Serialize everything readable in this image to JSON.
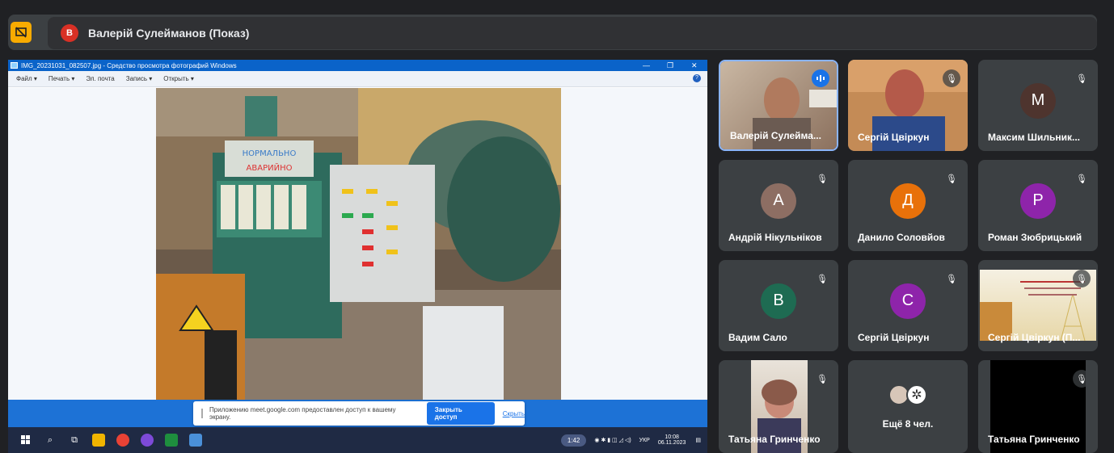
{
  "meet": {
    "presenter_initial": "В",
    "presenter_label": "Валерій Сулейманов (Показ)",
    "more_count_label": "Ещё 8 чел."
  },
  "screen": {
    "window_title": "IMG_20231031_082507.jpg - Средство просмотра фотографий Windows",
    "menu": [
      "Файл ▾",
      "Печать ▾",
      "Эл. почта",
      "Запись ▾",
      "Открыть ▾"
    ],
    "photo_sign_top": "НОРМАЛЬНО",
    "photo_sign_bottom": "АВАРИЙНО",
    "share_notice": "Приложению meet.google.com предоставлен доступ к вашему экрану.",
    "stop_sharing": "Закрыть доступ",
    "hide": "Скрыть",
    "tray_pill": "1:42",
    "tray_lang": "УКР",
    "time": "10:08",
    "date": "06.11.2023"
  },
  "participants": [
    {
      "name": "Валерій Сулейма...",
      "initial": "",
      "color": "",
      "type": "video-speaking"
    },
    {
      "name": "Сергій Цвіркун",
      "initial": "",
      "color": "",
      "type": "video-muted"
    },
    {
      "name": "Максим Шильник...",
      "initial": "М",
      "color": "#4e342e",
      "type": "avatar"
    },
    {
      "name": "Андрій Нікульніков",
      "initial": "А",
      "color": "#8d6e63",
      "type": "avatar"
    },
    {
      "name": "Данило Соловйов",
      "initial": "Д",
      "color": "#e8710a",
      "type": "avatar"
    },
    {
      "name": "Роман Зюбрицький",
      "initial": "Р",
      "color": "#8e24aa",
      "type": "avatar"
    },
    {
      "name": "Вадим Сало",
      "initial": "В",
      "color": "#1e6b52",
      "type": "avatar"
    },
    {
      "name": "Сергій Цвіркун",
      "initial": "С",
      "color": "#8e24aa",
      "type": "avatar"
    },
    {
      "name": "Сергій Цвіркун (П...",
      "initial": "",
      "color": "",
      "type": "slide"
    },
    {
      "name": "Татьяна Гринченко",
      "initial": "",
      "color": "",
      "type": "video-muted"
    },
    {
      "name": "Ещё 8 чел.",
      "initial": "",
      "color": "",
      "type": "more"
    },
    {
      "name": "Татьяна Гринченко",
      "initial": "",
      "color": "",
      "type": "black"
    }
  ],
  "colors": {
    "accent": "#1a73e8",
    "present": "#f9ab00",
    "tile": "#3c4043",
    "bg": "#202124"
  }
}
